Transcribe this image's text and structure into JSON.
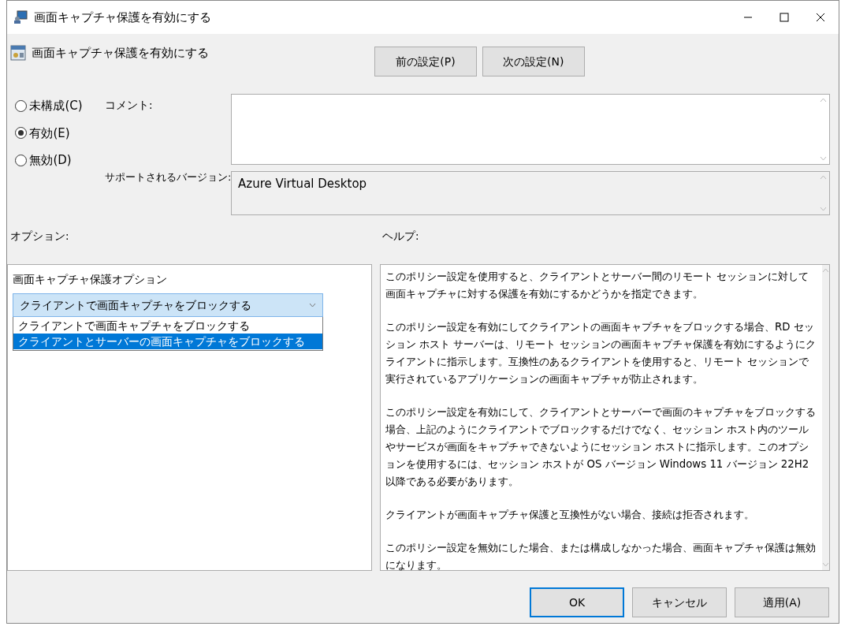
{
  "window": {
    "title": "画面キャプチャ保護を有効にする"
  },
  "header": {
    "title": "画面キャプチャ保護を有効にする"
  },
  "nav_buttons": [
    "前の設定(P)",
    "次の設定(N)"
  ],
  "state_options": [
    {
      "label": "未構成(C)",
      "selected": false
    },
    {
      "label": "有効(E)",
      "selected": true
    },
    {
      "label": "無効(D)",
      "selected": false
    }
  ],
  "comment": {
    "label": "コメント:"
  },
  "supported": {
    "label": "サポートされるバージョン:",
    "value": "Azure Virtual Desktop"
  },
  "options": {
    "label": "オプション:",
    "setting_label": "画面キャプチャ保護オプション",
    "dropdown": {
      "value": "クライアントで画面キャプチャをブロックする",
      "expanded": true,
      "items": [
        {
          "label": "クライアントで画面キャプチャをブロックする",
          "highlighted": false
        },
        {
          "label": "クライアントとサーバーの画面キャプチャをブロックする",
          "highlighted": true
        }
      ]
    }
  },
  "help": {
    "label": "ヘルプ:",
    "paragraphs": [
      "このポリシー設定を使用すると、クライアントとサーバー間のリモート セッションに対して画面キャプチャに対する保護を有効にするかどうかを指定できます。",
      "このポリシー設定を有効にしてクライアントの画面キャプチャをブロックする場合、RD セッション ホスト サーバーは、リモート セッションの画面キャプチャ保護を有効にするようにクライアントに指示します。互換性のあるクライアントを使用すると、リモート セッションで実行されているアプリケーションの画面キャプチャが防止されます。",
      "このポリシー設定を有効にして、クライアントとサーバーで画面のキャプチャをブロックする場合、上記のようにクライアントでブロックするだけでなく、セッション ホスト内のツールやサービスが画面をキャプチャできないようにセッション ホストに指示します。このオプションを使用するには、セッション ホストが OS バージョン Windows 11 バージョン 22H2 以降である必要があります。",
      "クライアントが画面キャプチャ保護と互換性がない場合、接続は拒否されます。",
      "このポリシー設定を無効にした場合、または構成しなかった場合、画面キャプチャ保護は無効になります。"
    ]
  },
  "buttons": [
    {
      "label": "OK",
      "default": true
    },
    {
      "label": "キャンセル",
      "default": false
    },
    {
      "label": "適用(A)",
      "default": false
    }
  ]
}
